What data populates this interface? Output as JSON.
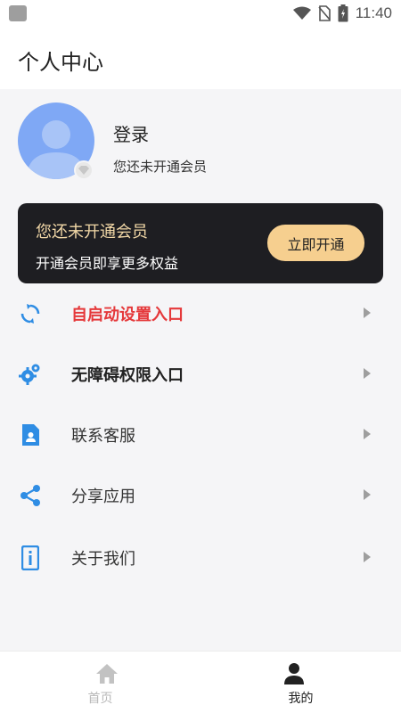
{
  "status_bar": {
    "time": "11:40"
  },
  "header": {
    "title": "个人中心"
  },
  "profile": {
    "login_label": "登录",
    "member_status": "您还未开通会员"
  },
  "vip_card": {
    "title": "您还未开通会员",
    "subtitle": "开通会员即享更多权益",
    "button_label": "立即开通"
  },
  "menu": {
    "items": [
      {
        "label": "自启动设置入口",
        "icon": "refresh-icon"
      },
      {
        "label": "无障碍权限入口",
        "icon": "gears-icon"
      },
      {
        "label": "联系客服",
        "icon": "contact-card-icon"
      },
      {
        "label": "分享应用",
        "icon": "share-icon"
      },
      {
        "label": "关于我们",
        "icon": "info-icon"
      }
    ]
  },
  "bottom_nav": {
    "tabs": [
      {
        "label": "首页",
        "icon": "home-icon",
        "active": false
      },
      {
        "label": "我的",
        "icon": "person-icon",
        "active": true
      }
    ]
  },
  "colors": {
    "accent_blue": "#2f8de4",
    "highlight_red": "#e5393b",
    "vip_gold": "#f2d8a7",
    "vip_button": "#f6cf8f"
  }
}
